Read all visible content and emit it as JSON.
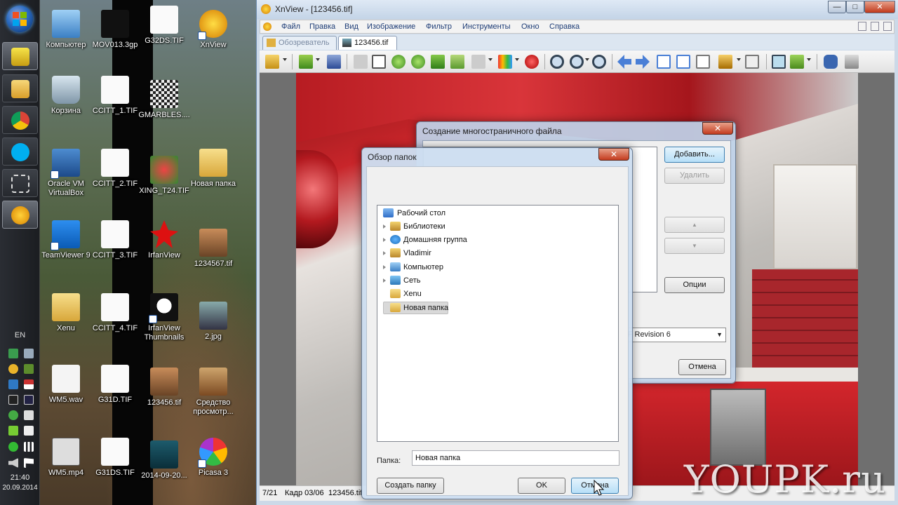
{
  "taskbar": {
    "lang": "EN",
    "time": "21:40",
    "date": "20.09.2014",
    "apps": [
      "Windows Start",
      "Movie app",
      "Windows Explorer",
      "Google Chrome",
      "Skype",
      "Snipping tool",
      "XnView"
    ]
  },
  "desktop": {
    "icons": [
      {
        "label": "Компьютер"
      },
      {
        "label": "MOV013.3gp"
      },
      {
        "label": "G32DS.TIF"
      },
      {
        "label": "XnView"
      },
      {
        "label": "Корзина"
      },
      {
        "label": "CCITT_1.TIF"
      },
      {
        "label": "GMARBLES...."
      },
      {
        "label": "Oracle VM VirtualBox"
      },
      {
        "label": "CCITT_2.TIF"
      },
      {
        "label": "XING_T24.TIF"
      },
      {
        "label": "Новая папка"
      },
      {
        "label": "TeamViewer 9"
      },
      {
        "label": "CCITT_3.TIF"
      },
      {
        "label": "IrfanView"
      },
      {
        "label": "1234567.tif"
      },
      {
        "label": "Xenu"
      },
      {
        "label": "CCITT_4.TIF"
      },
      {
        "label": "IrfanView Thumbnails"
      },
      {
        "label": "2.jpg"
      },
      {
        "label": "WM5.wav"
      },
      {
        "label": "G31D.TIF"
      },
      {
        "label": "123456.tif"
      },
      {
        "label": "Средство просмотр..."
      },
      {
        "label": "WM5.mp4"
      },
      {
        "label": "G31DS.TIF"
      },
      {
        "label": "2014-09-20..."
      },
      {
        "label": "Picasa 3"
      }
    ]
  },
  "xnview": {
    "title": "XnView - [123456.tif]",
    "menu": [
      "Файл",
      "Правка",
      "Вид",
      "Изображение",
      "Фильтр",
      "Инструменты",
      "Окно",
      "Справка"
    ],
    "tabs": [
      "Обозреватель",
      "123456.tif"
    ],
    "status": {
      "index": "7/21",
      "frame": "Кадр 03/06",
      "file": "123456.tif"
    }
  },
  "multipage_dialog": {
    "title": "Создание многостраничного файла",
    "add": "Добавить...",
    "remove": "Удалить",
    "up": "▲",
    "down": "▼",
    "options": "Опции",
    "format": "FF Revision 6",
    "cancel": "Отмена"
  },
  "browse_dialog": {
    "title": "Обзор папок",
    "tree": [
      {
        "label": "Рабочий стол",
        "expandable": false,
        "level": 0
      },
      {
        "label": "Библиотеки",
        "expandable": true,
        "level": 1
      },
      {
        "label": "Домашняя группа",
        "expandable": true,
        "level": 1
      },
      {
        "label": "Vladimir",
        "expandable": true,
        "level": 1
      },
      {
        "label": "Компьютер",
        "expandable": true,
        "level": 1
      },
      {
        "label": "Сеть",
        "expandable": true,
        "level": 1
      },
      {
        "label": "Xenu",
        "expandable": false,
        "level": 1
      },
      {
        "label": "Новая папка",
        "expandable": false,
        "level": 1,
        "selected": true
      }
    ],
    "folder_label": "Папка:",
    "folder_value": "Новая папка",
    "new_folder": "Создать папку",
    "ok": "OK",
    "cancel": "Отмена"
  },
  "watermark": "YOUPK.ru",
  "colors": {
    "accent": "#3c7fb1",
    "taskbar": "#1b1d21",
    "close": "#c43b1e"
  }
}
